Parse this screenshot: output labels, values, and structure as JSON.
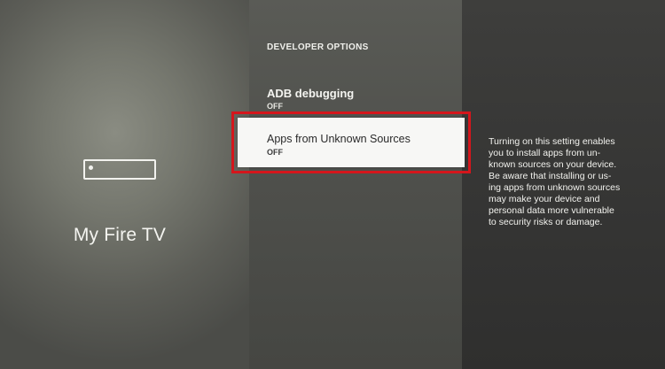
{
  "left_panel": {
    "icon": "fire-tv-device-icon",
    "title": "My Fire TV"
  },
  "settings": {
    "section_title": "DEVELOPER OPTIONS",
    "items": [
      {
        "label": "ADB debugging",
        "value": "OFF"
      },
      {
        "label": "Apps from Unknown Sources",
        "value": "OFF"
      }
    ],
    "selected_index": 1
  },
  "description": {
    "text": "Turning on this setting enables\nyou to install apps from un-\nknown sources on your device.\nBe aware that installing or us-\ning apps from unknown sources\nmay make your device and\npersonal data more vulnerable\nto security risks or damage."
  },
  "colors": {
    "highlight_border": "#d4161c",
    "selected_background": "#f7f7f5",
    "text": "#f4f4f0"
  }
}
